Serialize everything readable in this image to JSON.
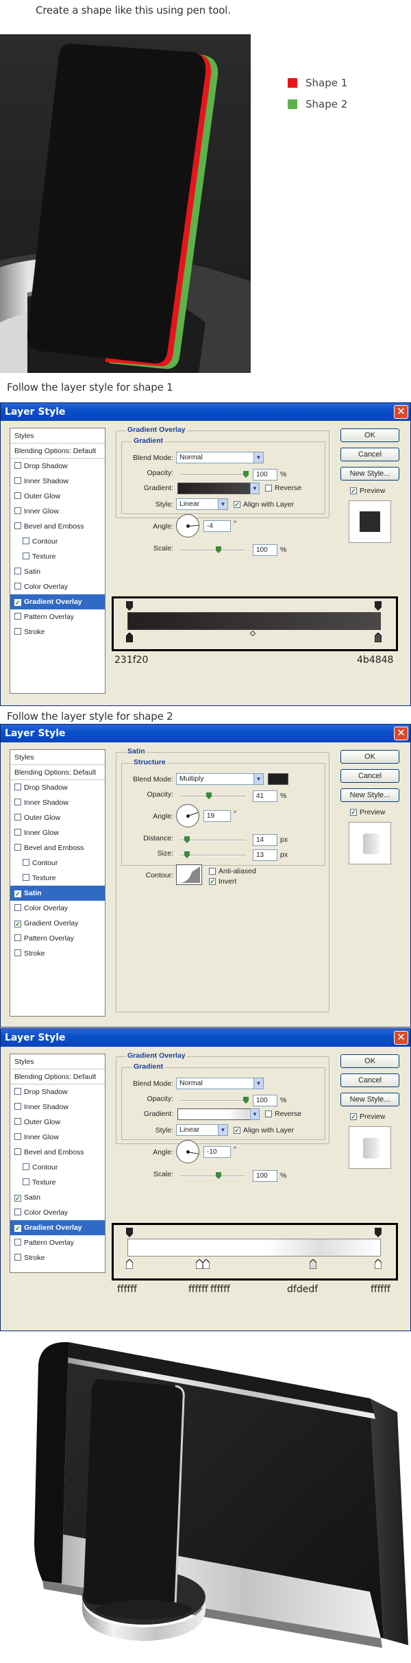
{
  "captions": {
    "intro": "Create a shape like this using pen tool.",
    "shape1": "Follow the layer style for shape 1",
    "shape2": "Follow the layer style for shape 2"
  },
  "legend": [
    {
      "label": "Shape 1",
      "color": "#e8141b"
    },
    {
      "label": "Shape 2",
      "color": "#5bb34a"
    }
  ],
  "dialog": {
    "title": "Layer Style",
    "close_label": "✕",
    "buttons": {
      "ok": "OK",
      "cancel": "Cancel",
      "new_style": "New Style...",
      "preview": "Preview"
    },
    "style_items": {
      "styles": "Styles",
      "blending": "Blending Options: Default",
      "drop_shadow": "Drop Shadow",
      "inner_shadow": "Inner Shadow",
      "outer_glow": "Outer Glow",
      "inner_glow": "Inner Glow",
      "bevel": "Bevel and Emboss",
      "contour": "Contour",
      "texture": "Texture",
      "satin": "Satin",
      "color_overlay": "Color Overlay",
      "gradient_overlay": "Gradient Overlay",
      "pattern_overlay": "Pattern Overlay",
      "stroke": "Stroke"
    }
  },
  "dialog1": {
    "section": "Gradient Overlay",
    "subsection": "Gradient",
    "blend_mode_label": "Blend Mode:",
    "blend_mode": "Normal",
    "opacity_label": "Opacity:",
    "opacity": "100",
    "opacity_pct": 1.0,
    "gradient_label": "Gradient:",
    "reverse": "Reverse",
    "style_label": "Style:",
    "style": "Linear",
    "align": "Align with Layer",
    "angle_label": "Angle:",
    "angle": "-4",
    "scale_label": "Scale:",
    "scale": "100",
    "scale_pct": 0.5,
    "unit_pct": "%",
    "unit_deg": "°",
    "stops": {
      "left": "231f20",
      "right": "4b4848"
    }
  },
  "dialog2": {
    "section": "Satin",
    "subsection": "Structure",
    "blend_mode_label": "Blend Mode:",
    "blend_mode": "Multiply",
    "opacity_label": "Opacity:",
    "opacity": "41",
    "angle_label": "Angle:",
    "angle": "19",
    "distance_label": "Distance:",
    "distance": "14",
    "size_label": "Size:",
    "size": "13",
    "contour_label": "Contour:",
    "anti_aliased": "Anti-aliased",
    "invert": "Invert",
    "unit_pct": "%",
    "unit_deg": "°",
    "unit_px": "px"
  },
  "dialog3": {
    "section": "Gradient Overlay",
    "subsection": "Gradient",
    "blend_mode_label": "Blend Mode:",
    "blend_mode": "Normal",
    "opacity_label": "Opacity:",
    "opacity": "100",
    "gradient_label": "Gradient:",
    "reverse": "Reverse",
    "style_label": "Style:",
    "style": "Linear",
    "align": "Align with Layer",
    "angle_label": "Angle:",
    "angle": "-10",
    "scale_label": "Scale:",
    "scale": "100",
    "unit_pct": "%",
    "unit_deg": "°",
    "stops": [
      "ffffff",
      "ffffff",
      "ffffff",
      "dfdedf",
      "ffffff"
    ]
  }
}
